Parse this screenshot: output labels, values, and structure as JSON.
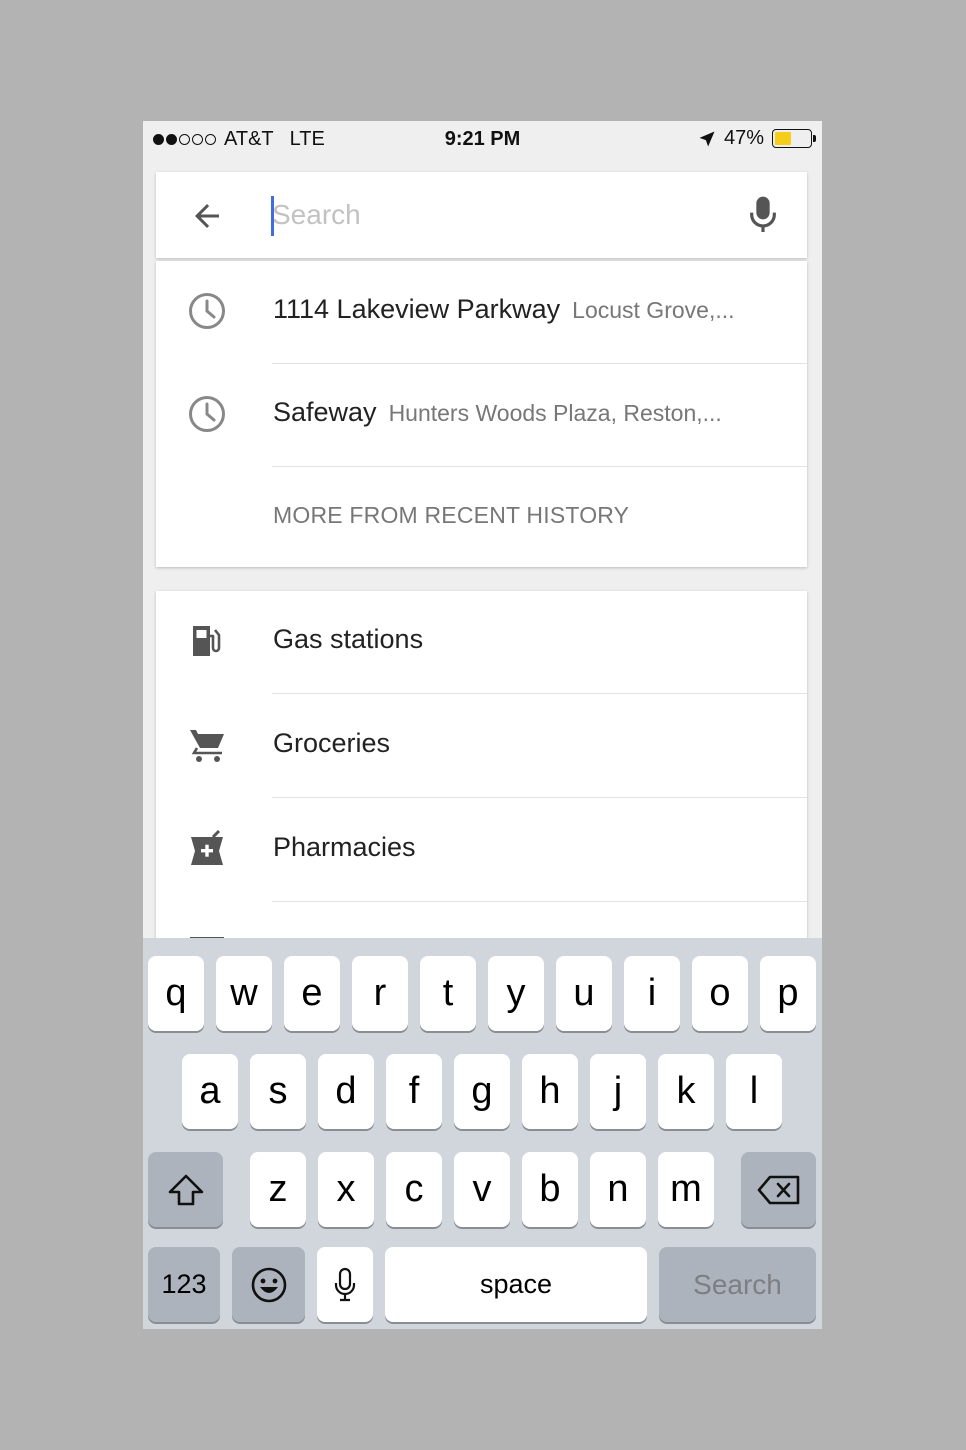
{
  "status_bar": {
    "carrier": "AT&T",
    "network": "LTE",
    "time": "9:21 PM",
    "battery": "47%",
    "battery_level": 0.47,
    "signal_bars": 2,
    "location_icon": "location-arrow-icon",
    "battery_color": "#f7cd1c"
  },
  "search": {
    "back_icon": "arrow-left-icon",
    "placeholder": "Search",
    "value": "",
    "mic_icon": "microphone-icon",
    "caret_color": "#3f6de0"
  },
  "recent": {
    "items": [
      {
        "icon": "history-clock-icon",
        "title": "1114 Lakeview Parkway",
        "subtitle": "Locust Grove,..."
      },
      {
        "icon": "history-clock-icon",
        "title": "Safeway",
        "subtitle": "Hunters Woods Plaza, Reston,..."
      }
    ],
    "more_label": "MORE FROM RECENT HISTORY"
  },
  "categories": {
    "items": [
      {
        "icon": "gas-station-icon",
        "label": "Gas stations"
      },
      {
        "icon": "shopping-cart-icon",
        "label": "Groceries"
      },
      {
        "icon": "pharmacy-icon",
        "label": "Pharmacies"
      }
    ]
  },
  "keyboard": {
    "row1": [
      "q",
      "w",
      "e",
      "r",
      "t",
      "y",
      "u",
      "i",
      "o",
      "p"
    ],
    "row2": [
      "a",
      "s",
      "d",
      "f",
      "g",
      "h",
      "j",
      "k",
      "l"
    ],
    "row3": [
      "z",
      "x",
      "c",
      "v",
      "b",
      "n",
      "m"
    ],
    "shift_icon": "shift-icon",
    "backspace_icon": "backspace-icon",
    "numbers_label": "123",
    "emoji_icon": "emoji-icon",
    "dictation_icon": "microphone-icon",
    "space_label": "space",
    "return_label": "Search"
  }
}
